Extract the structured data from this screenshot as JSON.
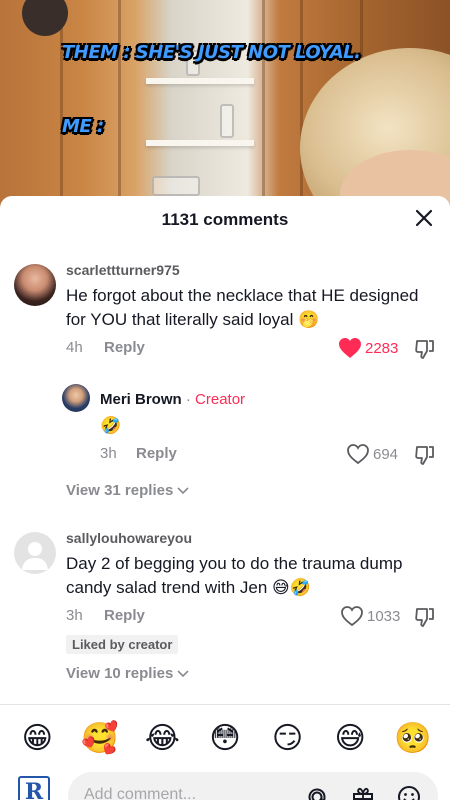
{
  "video": {
    "meme_top": "THEM : SHE'S JUST NOT LOYAL.",
    "meme_bottom": "ME :"
  },
  "sheet": {
    "title": "1131 comments"
  },
  "comments": [
    {
      "username": "scarlettturner975",
      "text": "He forgot about the necklace that HE designed for YOU that literally said loyal 🤭",
      "time": "4h",
      "reply_label": "Reply",
      "likes": "2283",
      "liked": true
    },
    {
      "username": "sallylouhowareyou",
      "text": "Day 2 of begging you to do the trauma dump candy salad trend with Jen 😅🤣",
      "time": "3h",
      "reply_label": "Reply",
      "likes": "1033",
      "liked": false,
      "badge": "Liked by creator",
      "view_replies": "View 10 replies"
    }
  ],
  "reply": {
    "username": "Meri Brown",
    "separator": "·",
    "tag": "Creator",
    "text": "🤣",
    "time": "3h",
    "reply_label": "Reply",
    "likes": "694"
  },
  "view_replies_1": "View 31 replies",
  "emoji_bar": [
    "😁",
    "🥰",
    "😂",
    "😳",
    "😏",
    "😅",
    "🥺"
  ],
  "input": {
    "placeholder": "Add comment..."
  },
  "colors": {
    "accent": "#fe2c55",
    "text_muted": "#8a8b91",
    "meme_blue": "#3f9bff"
  }
}
